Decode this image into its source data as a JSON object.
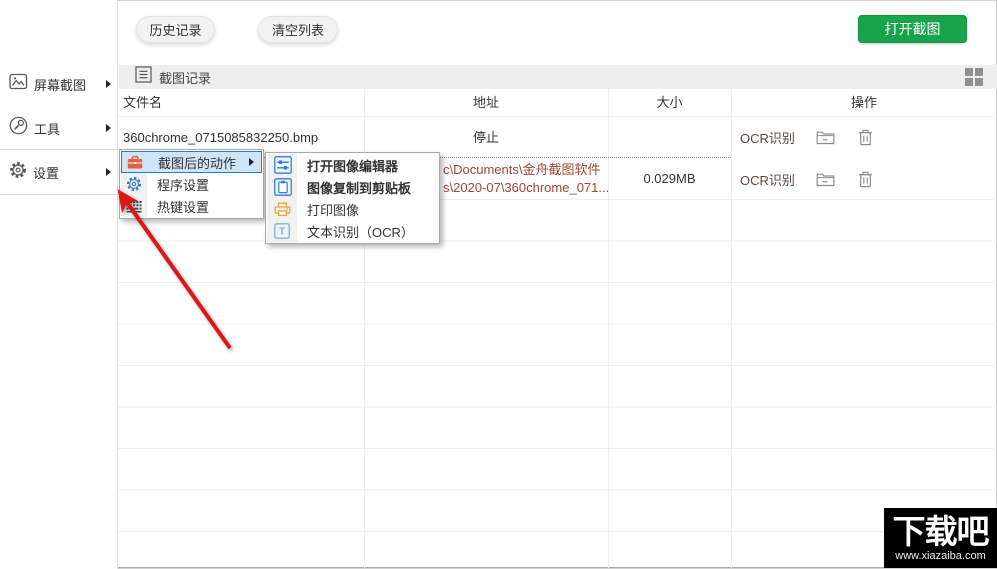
{
  "toolbar": {
    "history_label": "历史记录",
    "clear_label": "清空列表",
    "open_screenshot_label": "打开截图"
  },
  "sidebar": {
    "items": [
      {
        "label": "屏幕截图",
        "icon": "screen-capture-icon"
      },
      {
        "label": "工具",
        "icon": "tools-icon"
      },
      {
        "label": "设置",
        "icon": "settings-icon"
      }
    ]
  },
  "record_bar": {
    "title": "截图记录"
  },
  "table": {
    "headers": {
      "filename": "文件名",
      "address": "地址",
      "size": "大小",
      "actions": "操作"
    },
    "rows": [
      {
        "filename": "360chrome_0715085832250.bmp",
        "address": "停止",
        "size": "",
        "ocr_label": "OCR识别"
      },
      {
        "filename": "",
        "address_line1": "c\\Documents\\金舟截图软件",
        "address_line2": "s\\2020-07\\360chrome_071...",
        "size": "0.029MB",
        "ocr_label": "OCR识别"
      }
    ]
  },
  "context_menu": {
    "items": [
      {
        "label": "截图后的动作",
        "selected": true,
        "icon": "toolbox-icon"
      },
      {
        "label": "程序设置",
        "icon": "gear-icon"
      },
      {
        "label": "热键设置",
        "icon": "keyboard-icon"
      }
    ]
  },
  "submenu": {
    "items": [
      {
        "label": "打开图像编辑器",
        "bold": true,
        "icon": "sliders-icon"
      },
      {
        "label": "图像复制到剪贴板",
        "bold": true,
        "icon": "clipboard-icon"
      },
      {
        "label": "打印图像",
        "bold": false,
        "icon": "printer-icon"
      },
      {
        "label": "文本识别（OCR）",
        "bold": false,
        "icon": "ocr-text-icon"
      }
    ]
  },
  "icons": {
    "ocr_letter": "T"
  },
  "watermark": {
    "name": "下载吧",
    "url": "www.xiazaiba.com"
  },
  "colors": {
    "accent_green": "#17a44b",
    "menu_highlight_bg": "#cde5f7",
    "menu_highlight_border": "#2e79bd",
    "address_text": "#9c4636",
    "arrow_red": "#dd1812",
    "bar_bg": "#eeeeee"
  }
}
